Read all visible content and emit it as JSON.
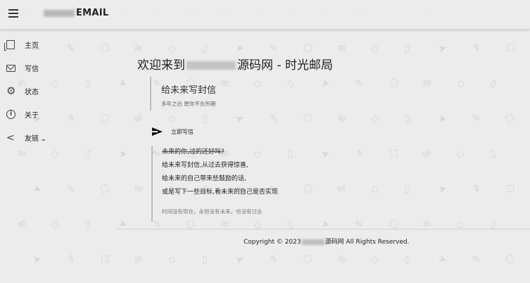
{
  "app": {
    "brand_suffix": "EMAIL"
  },
  "sidebar": {
    "items": [
      {
        "label": "主页",
        "icon": "page-icon"
      },
      {
        "label": "写信",
        "icon": "mail-icon"
      },
      {
        "label": "状态",
        "icon": "gear-icon"
      },
      {
        "label": "关于",
        "icon": "info-icon"
      },
      {
        "label": "友链",
        "icon": "share-icon",
        "has_dropdown": true
      }
    ]
  },
  "main": {
    "title_prefix": "欢迎来到",
    "title_suffix": "源码网 - 时光邮局",
    "quote_title": "给未来写封信",
    "quote_sub": "多年之后 愿你不负所期",
    "write_button": "立即写信",
    "poem": [
      "未来的你,过的还好吗?",
      "给未来写封信,从过去获得惊喜,",
      "给未来的自己带来些鼓励的话,",
      "或是写下一些目标,看未来的自己是否实现"
    ],
    "poem_note": "时间没有现在，永恒没有未来，也没有过去"
  },
  "footer": {
    "prefix": "Copyright © 2023",
    "suffix": "源码网 All Rights Reserved."
  },
  "colors": {
    "background": "#ececec",
    "text": "#222222",
    "accent_line": "#bdbdbd"
  }
}
